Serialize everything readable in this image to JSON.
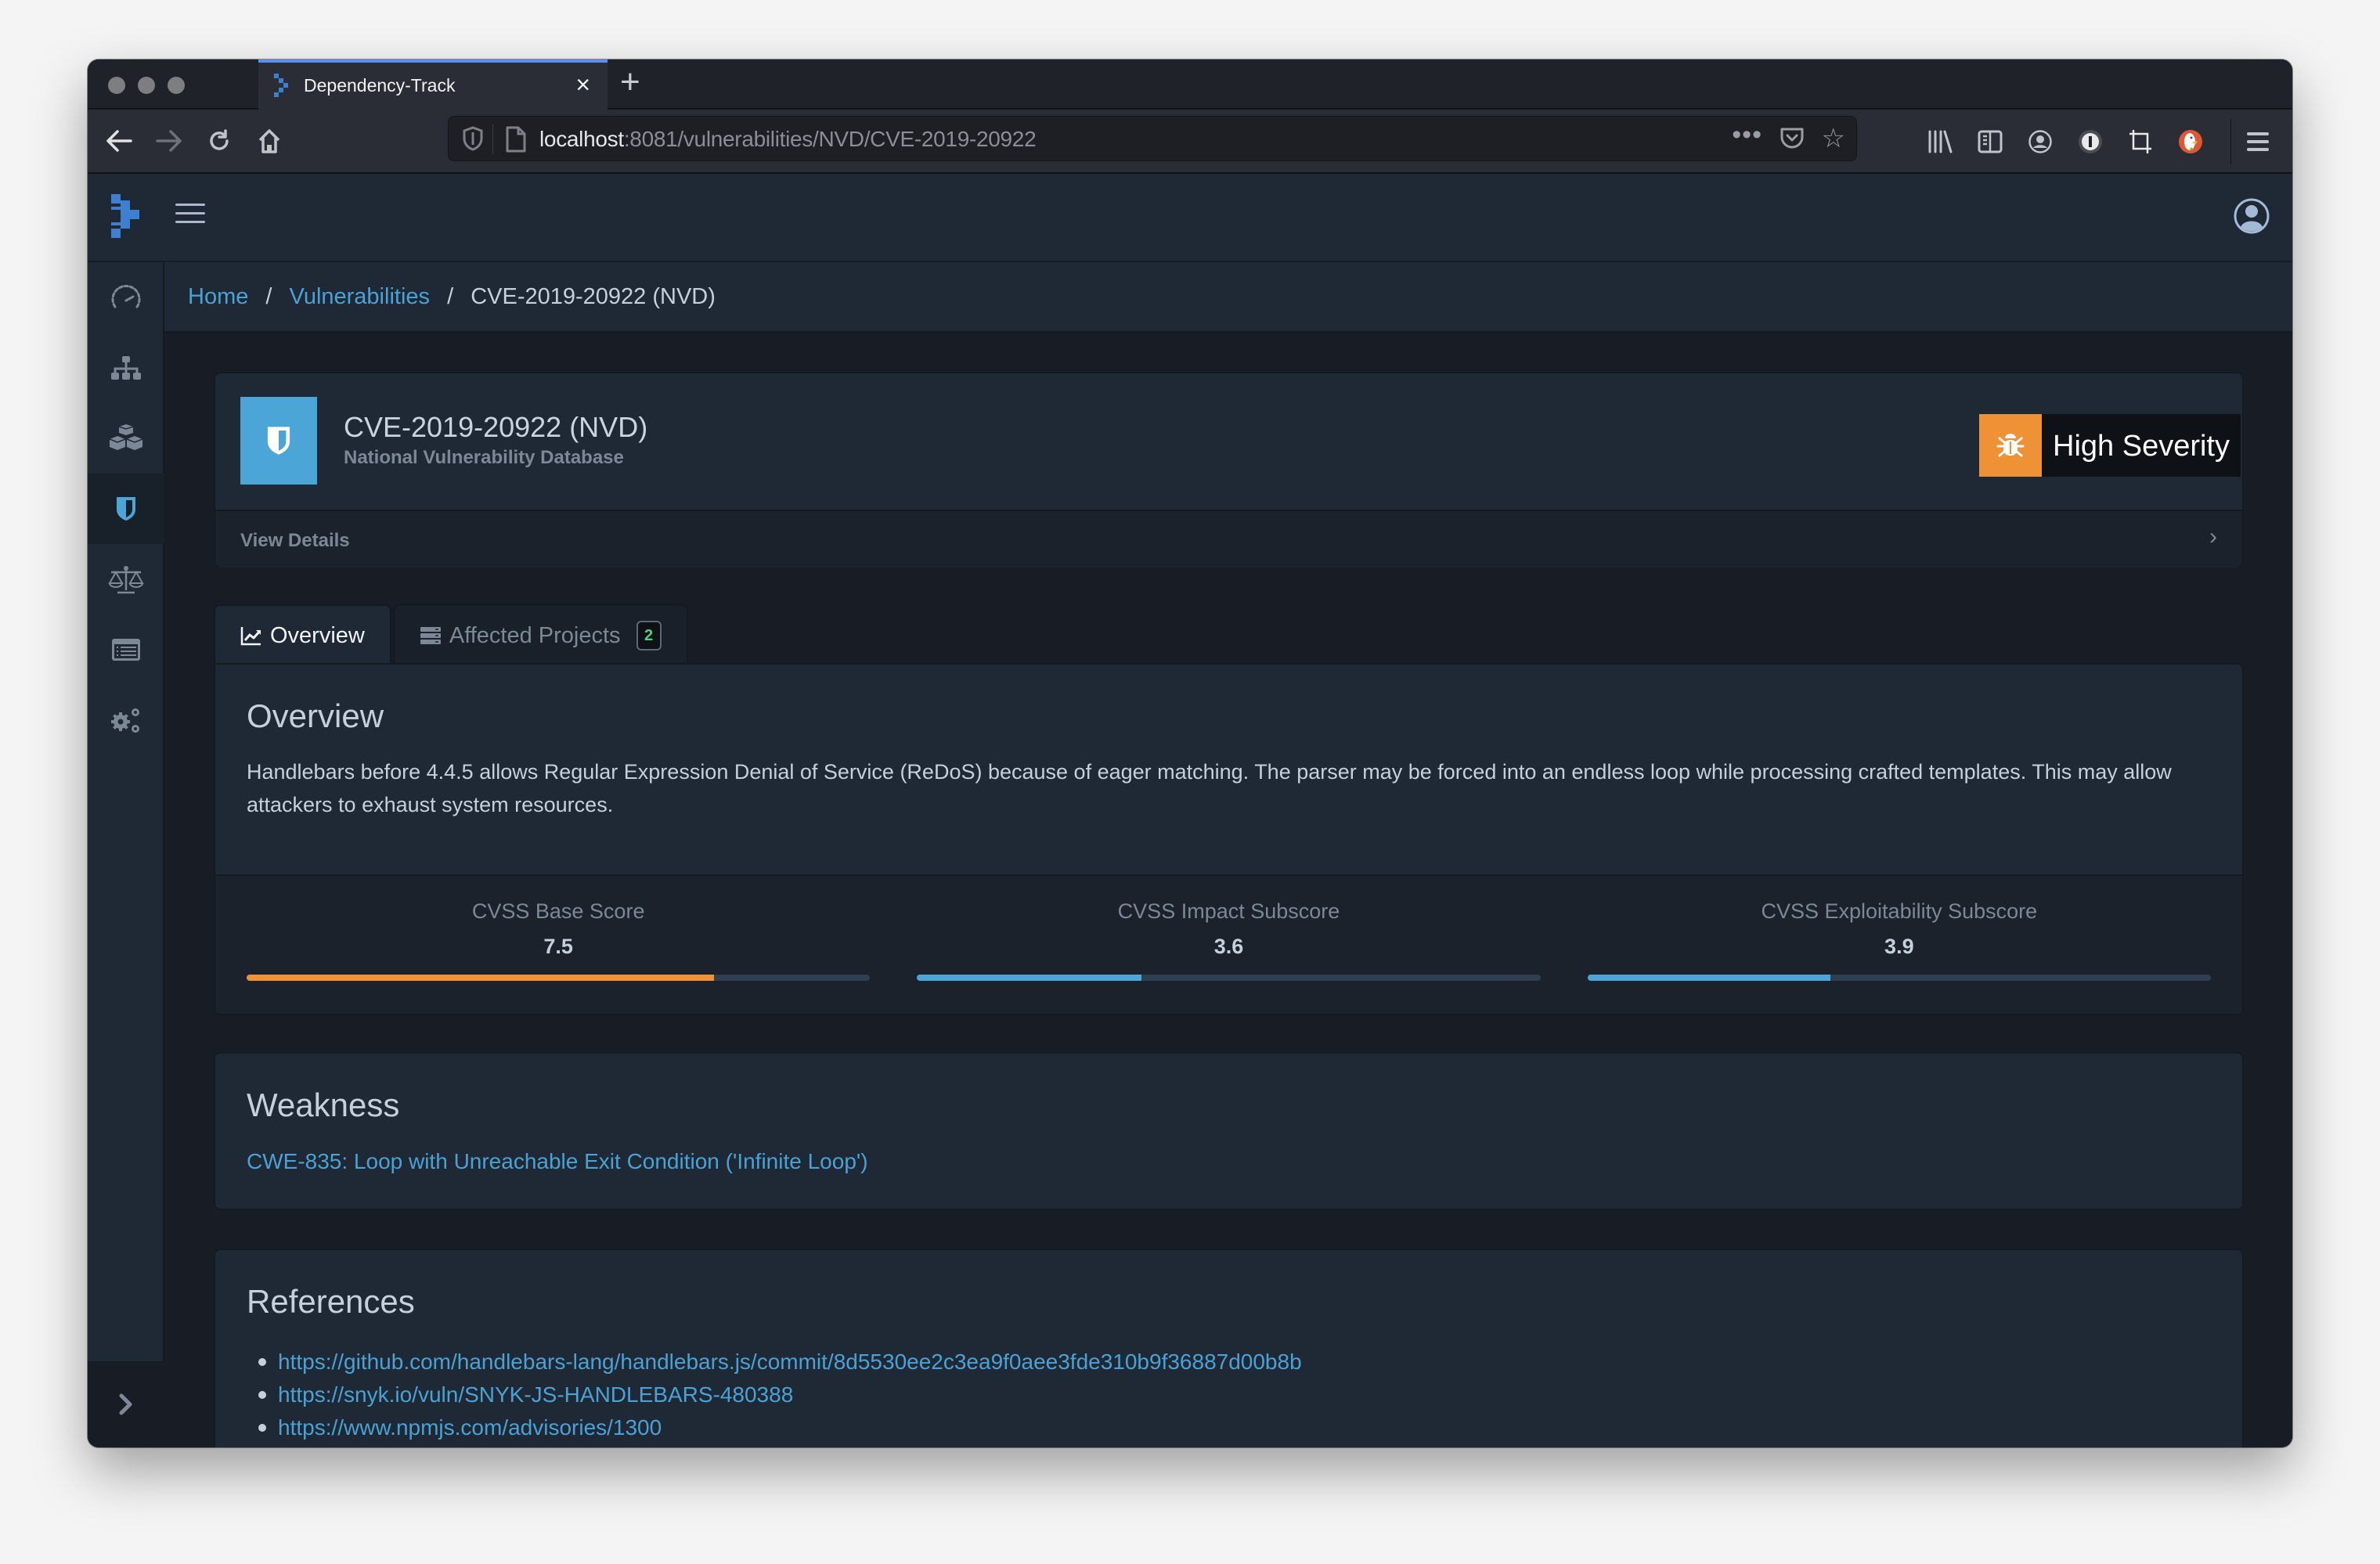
{
  "browser": {
    "tab_title": "Dependency-Track",
    "new_tab_label": "+",
    "url_host": "localhost",
    "url_rest": ":8081/vulnerabilities/NVD/CVE-2019-20922",
    "overflow_menu": "•••"
  },
  "sidebar": {
    "items": [
      {
        "name": "dashboard",
        "icon": "speedometer-icon"
      },
      {
        "name": "projects",
        "icon": "sitemap-icon"
      },
      {
        "name": "components",
        "icon": "cubes-icon"
      },
      {
        "name": "vulnerabilities",
        "icon": "shield-icon",
        "active": true
      },
      {
        "name": "licenses",
        "icon": "balance-scale-icon"
      },
      {
        "name": "tags",
        "icon": "list-alt-icon"
      },
      {
        "name": "administration",
        "icon": "cogs-icon"
      }
    ]
  },
  "breadcrumb": {
    "home": "Home",
    "vulnerabilities": "Vulnerabilities",
    "current": "CVE-2019-20922 (NVD)",
    "separator": "/"
  },
  "vulnerability": {
    "title": "CVE-2019-20922 (NVD)",
    "source": "National Vulnerability Database",
    "severity_label": "High Severity",
    "severity_color": "#ef9135",
    "view_details": "View Details"
  },
  "tabs": [
    {
      "label": "Overview",
      "icon": "line-chart-icon",
      "active": true
    },
    {
      "label": "Affected Projects",
      "icon": "server-icon",
      "badge": "2",
      "active": false
    }
  ],
  "overview": {
    "heading": "Overview",
    "description": "Handlebars before 4.4.5 allows Regular Expression Denial of Service (ReDoS) because of eager matching. The parser may be forced into an endless loop while processing crafted templates. This may allow attackers to exhaust system resources.",
    "scores": [
      {
        "label": "CVSS Base Score",
        "value": "7.5",
        "fraction": 0.75,
        "color": "#ef9135"
      },
      {
        "label": "CVSS Impact Subscore",
        "value": "3.6",
        "fraction": 0.36,
        "color": "#4ba5d6"
      },
      {
        "label": "CVSS Exploitability Subscore",
        "value": "3.9",
        "fraction": 0.39,
        "color": "#4ba5d6"
      }
    ]
  },
  "weakness": {
    "heading": "Weakness",
    "cwe": "CWE-835: Loop with Unreachable Exit Condition ('Infinite Loop')"
  },
  "references": {
    "heading": "References",
    "links": [
      "https://github.com/handlebars-lang/handlebars.js/commit/8d5530ee2c3ea9f0aee3fde310b9f36887d00b8b",
      "https://snyk.io/vuln/SNYK-JS-HANDLEBARS-480388",
      "https://www.npmjs.com/advisories/1300"
    ]
  }
}
